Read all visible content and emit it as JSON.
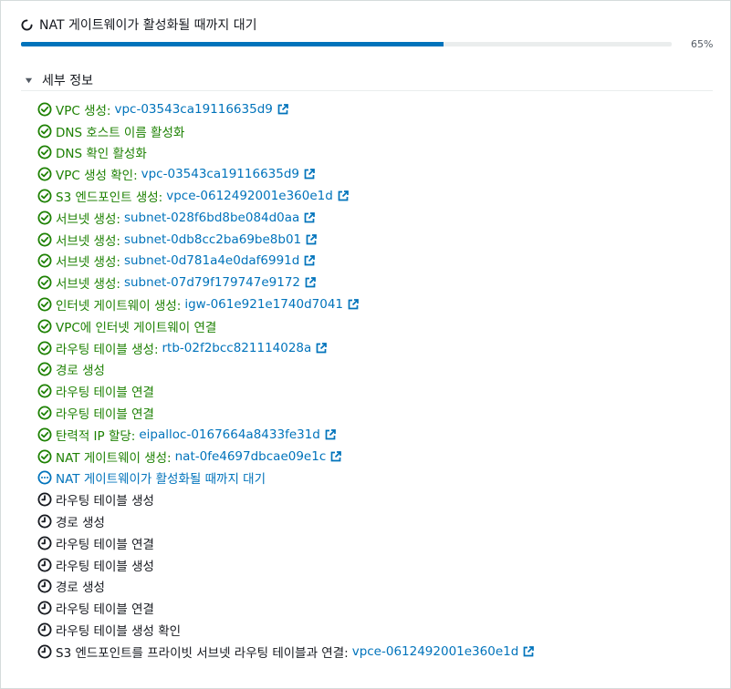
{
  "header": {
    "title": "NAT 게이트웨이가 활성화될 때까지 대기",
    "progress_percent": 65,
    "progress_label": "65%"
  },
  "details": {
    "label": "세부 정보",
    "expanded": true
  },
  "colors": {
    "success": "#1d8102",
    "in_progress": "#0073bb",
    "pending": "#16191f",
    "link": "#0073bb",
    "progress_bar": "#0073bb"
  },
  "steps": [
    {
      "status": "success",
      "label": "VPC 생성:",
      "link": "vpc-03543ca19116635d9",
      "icon": "check-circle-icon"
    },
    {
      "status": "success",
      "label": "DNS 호스트 이름 활성화",
      "icon": "check-circle-icon"
    },
    {
      "status": "success",
      "label": "DNS 확인 활성화",
      "icon": "check-circle-icon"
    },
    {
      "status": "success",
      "label": "VPC 생성 확인:",
      "link": "vpc-03543ca19116635d9",
      "icon": "check-circle-icon"
    },
    {
      "status": "success",
      "label": "S3 엔드포인트 생성:",
      "link": "vpce-0612492001e360e1d",
      "icon": "check-circle-icon"
    },
    {
      "status": "success",
      "label": "서브넷 생성:",
      "link": "subnet-028f6bd8be084d0aa",
      "icon": "check-circle-icon"
    },
    {
      "status": "success",
      "label": "서브넷 생성:",
      "link": "subnet-0db8cc2ba69be8b01",
      "icon": "check-circle-icon"
    },
    {
      "status": "success",
      "label": "서브넷 생성:",
      "link": "subnet-0d781a4e0daf6991d",
      "icon": "check-circle-icon"
    },
    {
      "status": "success",
      "label": "서브넷 생성:",
      "link": "subnet-07d79f179747e9172",
      "icon": "check-circle-icon"
    },
    {
      "status": "success",
      "label": "인터넷 게이트웨이 생성:",
      "link": "igw-061e921e1740d7041",
      "icon": "check-circle-icon"
    },
    {
      "status": "success",
      "label": "VPC에 인터넷 게이트웨이 연결",
      "icon": "check-circle-icon"
    },
    {
      "status": "success",
      "label": "라우팅 테이블 생성:",
      "link": "rtb-02f2bcc821114028a",
      "icon": "check-circle-icon"
    },
    {
      "status": "success",
      "label": "경로 생성",
      "icon": "check-circle-icon"
    },
    {
      "status": "success",
      "label": "라우팅 테이블 연결",
      "icon": "check-circle-icon"
    },
    {
      "status": "success",
      "label": "라우팅 테이블 연결",
      "icon": "check-circle-icon"
    },
    {
      "status": "success",
      "label": "탄력적 IP 할당:",
      "link": "eipalloc-0167664a8433fe31d",
      "icon": "check-circle-icon"
    },
    {
      "status": "success",
      "label": "NAT 게이트웨이 생성:",
      "link": "nat-0fe4697dbcae09e1c",
      "icon": "check-circle-icon"
    },
    {
      "status": "in-progress",
      "label": "NAT 게이트웨이가 활성화될 때까지 대기",
      "icon": "in-progress-icon"
    },
    {
      "status": "pending",
      "label": "라우팅 테이블 생성",
      "icon": "clock-icon"
    },
    {
      "status": "pending",
      "label": "경로 생성",
      "icon": "clock-icon"
    },
    {
      "status": "pending",
      "label": "라우팅 테이블 연결",
      "icon": "clock-icon"
    },
    {
      "status": "pending",
      "label": "라우팅 테이블 생성",
      "icon": "clock-icon"
    },
    {
      "status": "pending",
      "label": "경로 생성",
      "icon": "clock-icon"
    },
    {
      "status": "pending",
      "label": "라우팅 테이블 연결",
      "icon": "clock-icon"
    },
    {
      "status": "pending",
      "label": "라우팅 테이블 생성 확인",
      "icon": "clock-icon"
    },
    {
      "status": "pending",
      "label": "S3 엔드포인트를 프라이빗 서브넷 라우팅 테이블과 연결:",
      "link": "vpce-0612492001e360e1d",
      "icon": "clock-icon"
    }
  ]
}
